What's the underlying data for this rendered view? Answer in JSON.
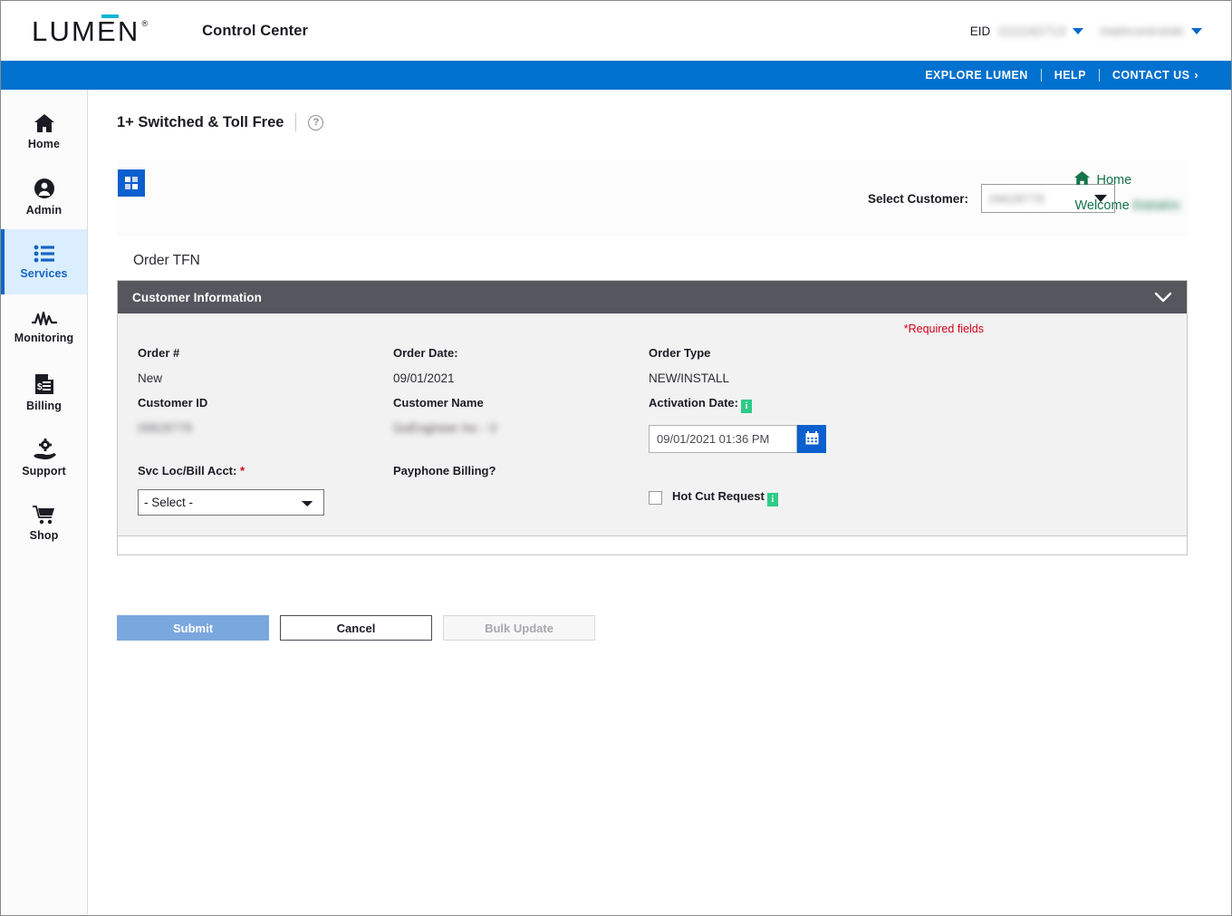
{
  "header": {
    "logo_text": "LUMEN",
    "logo_registered": "®",
    "app_title": "Control Center",
    "eid_label": "EID",
    "eid_value": "1111162713",
    "user_value": "mathcontrolski"
  },
  "nav": {
    "explore": "EXPLORE LUMEN",
    "help": "HELP",
    "contact": "CONTACT US",
    "contact_chevron": "›"
  },
  "sidebar": {
    "items": [
      {
        "label": "Home",
        "icon": "home-icon",
        "active": false
      },
      {
        "label": "Admin",
        "icon": "user-circle-icon",
        "active": false
      },
      {
        "label": "Services",
        "icon": "list-icon",
        "active": true
      },
      {
        "label": "Monitoring",
        "icon": "pulse-icon",
        "active": false
      },
      {
        "label": "Billing",
        "icon": "invoice-icon",
        "active": false
      },
      {
        "label": "Support",
        "icon": "hand-gear-icon",
        "active": false
      },
      {
        "label": "Shop",
        "icon": "cart-icon",
        "active": false
      }
    ]
  },
  "page": {
    "title": "1+ Switched & Toll Free",
    "help_glyph": "?"
  },
  "customer_bar": {
    "grid_button": "apps-grid-button",
    "select_customer_label": "Select Customer:",
    "select_customer_value": "09628778",
    "home_link": "Home",
    "welcome_label": "Welcome",
    "welcome_name": "ktatakis"
  },
  "order": {
    "section_title": "Order TFN",
    "panel_title": "Customer Information",
    "required_note": "*Required fields",
    "fields": {
      "order_number_label": "Order #",
      "order_number_value": "New",
      "order_date_label": "Order Date:",
      "order_date_value": "09/01/2021",
      "order_type_label": "Order Type",
      "order_type_value": "NEW/INSTALL",
      "customer_id_label": "Customer ID",
      "customer_id_value": "09628778",
      "customer_name_label": "Customer Name",
      "customer_name_value": "GoEngineer Inc - V",
      "activation_date_label": "Activation Date:",
      "activation_date_value": "09/01/2021 01:36 PM",
      "svc_loc_label": "Svc Loc/Bill Acct:",
      "svc_loc_required": "*",
      "svc_loc_value": "- Select -",
      "payphone_label": "Payphone Billing?",
      "hot_cut_label": "Hot Cut Request",
      "info_glyph": "i"
    }
  },
  "buttons": {
    "submit": "Submit",
    "cancel": "Cancel",
    "bulk_update": "Bulk Update"
  },
  "colors": {
    "brand_blue": "#0071ce",
    "accent_teal": "#0bb4d4",
    "panel_header": "#56565e",
    "green_link": "#15734a",
    "required_red": "#d0021b",
    "info_green": "#2ecc88"
  }
}
